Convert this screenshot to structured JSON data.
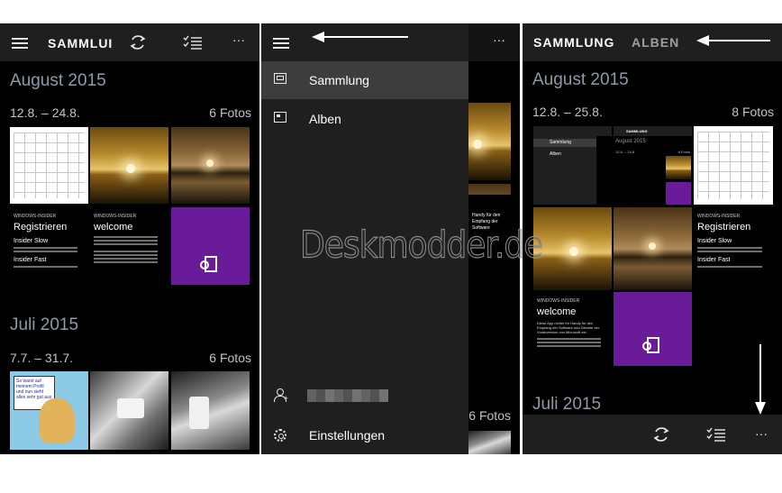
{
  "colors": {
    "panel_bg": "#000000",
    "bar_bg": "#1f1f1f",
    "accent_purple": "#6a1b9a",
    "month_text": "#8e9aa8"
  },
  "panel1": {
    "title": "SAMMLUI",
    "icons": [
      "hamburger-icon",
      "refresh-icon",
      "select-icon",
      "more-icon"
    ],
    "more_label": "···",
    "sections": [
      {
        "month": "August 2015",
        "range": "12.8. – 24.8.",
        "count": "6 Fotos"
      },
      {
        "month": "Juli 2015",
        "range": "7.7. – 31.7.",
        "count": "6 Fotos"
      }
    ],
    "thumb_text": {
      "win1": {
        "header": "WINDOWS-INSIDER",
        "heading": "Registrieren",
        "sub1": "Insider Slow",
        "sub2": "Insider Fast"
      },
      "win2": {
        "header": "WINDOWS-INSIDER",
        "heading": "welcome"
      },
      "cartoon": "So warst auf meinem Profil und nun sieht alles sehr gut aus"
    }
  },
  "panel2": {
    "more_label": "···",
    "nav_items": [
      {
        "label": "Sammlung",
        "selected": true
      },
      {
        "label": "Alben",
        "selected": false
      }
    ],
    "settings_label": "Einstellungen",
    "behind_count": "6 Fotos",
    "behind_text": "Handy für den Empfang der Software"
  },
  "panel3": {
    "tab_active": "SAMMLUNG",
    "tab_inactive": "ALBEN",
    "sections": [
      {
        "month": "August 2015",
        "range": "12.8. – 25.8.",
        "count": "8 Fotos"
      },
      {
        "month": "Juli 2015"
      }
    ],
    "mini": {
      "title": "SAMMLUNG",
      "nav1": "Sammlung",
      "nav2": "Alben",
      "month": "August 2015",
      "range": "12.8. – 24.8.",
      "count": "6 Fotos"
    },
    "thumb_text": {
      "win1": {
        "header": "WINDOWS-INSIDER",
        "heading": "Registrieren",
        "sub1": "Insider Slow",
        "sub2": "Insider Fast"
      },
      "win2": {
        "header": "WINDOWS-INSIDER",
        "heading": "welcome",
        "body": "Diese App richtet Ihr Handy für den Empfang der Software und Dienste der Vorabversion von Microsoft ein."
      }
    },
    "more_label": "···"
  },
  "watermark": "Deskmodder.de"
}
